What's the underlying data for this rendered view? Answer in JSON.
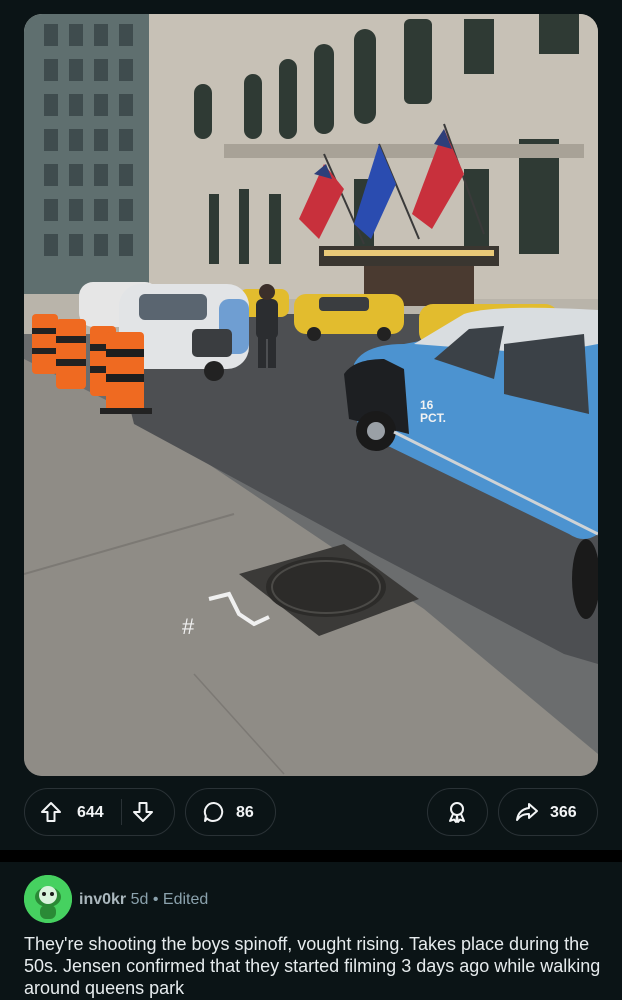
{
  "post": {
    "image_alt": "Street scene with vintage cars on a film set",
    "upvotes": "644",
    "comments": "86",
    "shares": "366",
    "image_text": {
      "car_door": "16\nPCT.",
      "pavement_mark": "#1"
    }
  },
  "comment": {
    "username": "inv0kr",
    "age": "5d",
    "dot": "•",
    "edited": "Edited",
    "text": "They're shooting the boys spinoff, vought rising. Takes place during the 50s. Jensen confirmed that they started filming 3 days ago while walking around queens park"
  },
  "colors": {
    "background": "#0b1416",
    "pill_border": "#2a3236",
    "avatar": "#46d160"
  },
  "icons": [
    "upvote-arrow-icon",
    "downvote-arrow-icon",
    "comment-bubble-icon",
    "award-icon",
    "share-arrow-icon"
  ]
}
